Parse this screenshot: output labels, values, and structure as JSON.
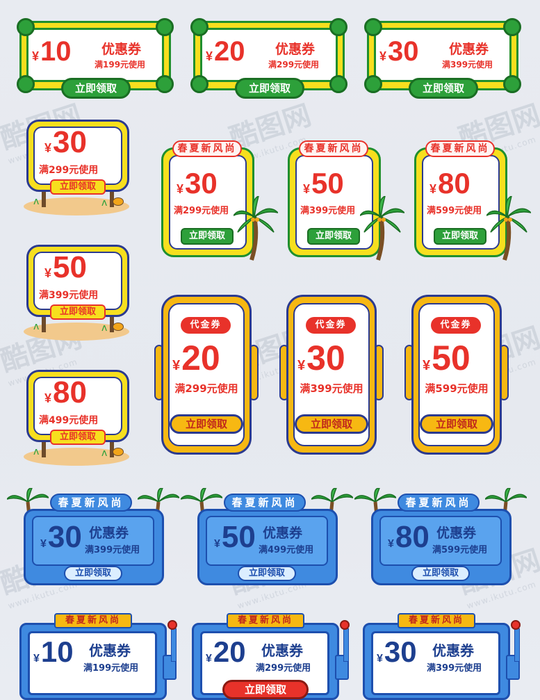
{
  "watermark": {
    "logo": "酷图网",
    "url": "www.ikutu.com"
  },
  "row1": [
    {
      "amount": "10",
      "currency": "¥",
      "title": "优惠券",
      "condition": "满199元使用",
      "button": "立即领取"
    },
    {
      "amount": "20",
      "currency": "¥",
      "title": "优惠券",
      "condition": "满299元使用",
      "button": "立即领取"
    },
    {
      "amount": "30",
      "currency": "¥",
      "title": "优惠券",
      "condition": "满399元使用",
      "button": "立即领取"
    }
  ],
  "signboards": [
    {
      "amount": "30",
      "currency": "¥",
      "condition": "满299元使用",
      "button": "立即领取"
    },
    {
      "amount": "50",
      "currency": "¥",
      "condition": "满399元使用",
      "button": "立即领取"
    },
    {
      "amount": "80",
      "currency": "¥",
      "condition": "满499元使用",
      "button": "立即领取"
    }
  ],
  "palm_tags": [
    {
      "tag": "春夏新风尚",
      "amount": "30",
      "currency": "¥",
      "condition": "满299元使用",
      "button": "立即领取"
    },
    {
      "tag": "春夏新风尚",
      "amount": "50",
      "currency": "¥",
      "condition": "满399元使用",
      "button": "立即领取"
    },
    {
      "tag": "春夏新风尚",
      "amount": "80",
      "currency": "¥",
      "condition": "满599元使用",
      "button": "立即领取"
    }
  ],
  "voucher_tickets": [
    {
      "tag": "代金券",
      "amount": "20",
      "currency": "¥",
      "condition": "满299元使用",
      "button": "立即领取"
    },
    {
      "tag": "代金券",
      "amount": "30",
      "currency": "¥",
      "condition": "满399元使用",
      "button": "立即领取"
    },
    {
      "tag": "代金券",
      "amount": "50",
      "currency": "¥",
      "condition": "满599元使用",
      "button": "立即领取"
    }
  ],
  "blue_palms": [
    {
      "tag": "春夏新风尚",
      "amount": "30",
      "currency": "¥",
      "title": "优惠券",
      "condition": "满399元使用",
      "button": "立即领取"
    },
    {
      "tag": "春夏新风尚",
      "amount": "50",
      "currency": "¥",
      "title": "优惠券",
      "condition": "满499元使用",
      "button": "立即领取"
    },
    {
      "tag": "春夏新风尚",
      "amount": "80",
      "currency": "¥",
      "title": "优惠券",
      "condition": "满599元使用",
      "button": "立即领取"
    }
  ],
  "slot_machines": [
    {
      "tag": "春夏新风尚",
      "amount": "10",
      "currency": "¥",
      "title": "优惠券",
      "condition": "满199元使用"
    },
    {
      "tag": "春夏新风尚",
      "amount": "20",
      "currency": "¥",
      "title": "优惠券",
      "condition": "满299元使用",
      "button": "立即领取"
    },
    {
      "tag": "春夏新风尚",
      "amount": "30",
      "currency": "¥",
      "title": "优惠券",
      "condition": "满399元使用"
    }
  ],
  "colors": {
    "red": "#e8322a",
    "green": "#2da03a",
    "yellow": "#f7df1e",
    "blue": "#3f8ae0",
    "navy": "#1d3f8f"
  }
}
